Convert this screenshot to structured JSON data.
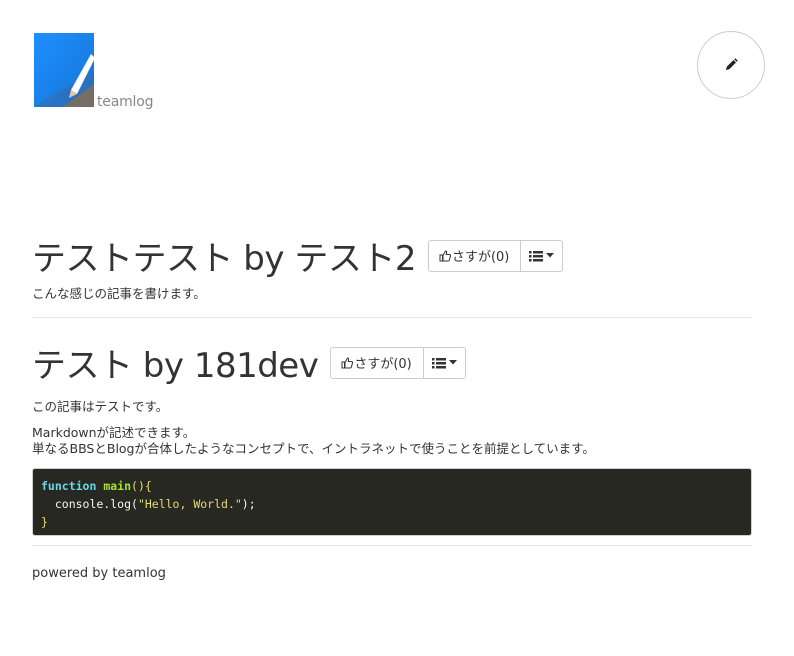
{
  "brand": {
    "logo_text": "teamlog",
    "logo_color": "#1e90ff"
  },
  "header": {
    "edit_icon": "pencil-icon"
  },
  "articles": [
    {
      "title": "テストテスト by テスト2",
      "like_label": "さすが(0)",
      "paragraphs": [
        "こんな感じの記事を書けます。"
      ]
    },
    {
      "title": "テスト by 181dev",
      "like_label": "さすが(0)",
      "paragraphs": [
        "この記事はテストです。",
        "Markdownが記述できます。",
        "単なるBBSとBlogが合体したようなコンセプトで、イントラネットで使うことを前提としています。"
      ],
      "code": {
        "keyword": "function",
        "fn_name": "main",
        "line1_rest": "(){",
        "line2_prefix": "  console.log(",
        "line2_string": "\"Hello, World.\"",
        "line2_suffix": ");",
        "line3": "}"
      }
    }
  ],
  "footer": {
    "text": "powered by teamlog"
  }
}
